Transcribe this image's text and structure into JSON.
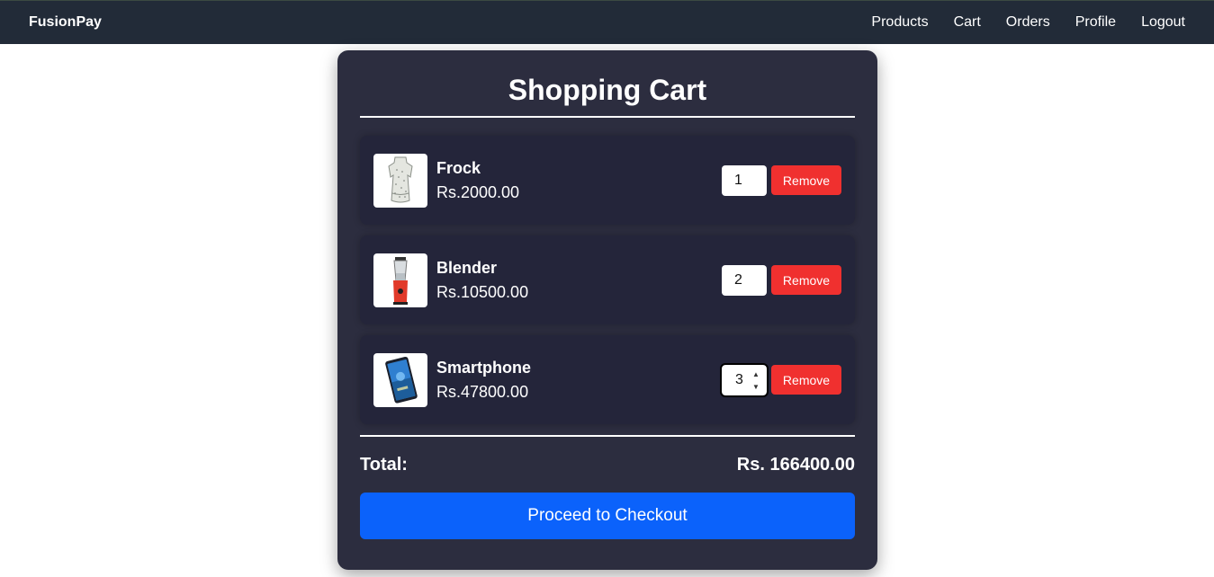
{
  "nav": {
    "brand": "FusionPay",
    "links": [
      "Products",
      "Cart",
      "Orders",
      "Profile",
      "Logout"
    ]
  },
  "cart": {
    "title": "Shopping Cart",
    "items": [
      {
        "name": "Frock",
        "price": "Rs.2000.00",
        "qty": "1",
        "remove_label": "Remove",
        "image_icon": "frock-image"
      },
      {
        "name": "Blender",
        "price": "Rs.10500.00",
        "qty": "2",
        "remove_label": "Remove",
        "image_icon": "blender-image"
      },
      {
        "name": "Smartphone",
        "price": "Rs.47800.00",
        "qty": "3",
        "remove_label": "Remove",
        "image_icon": "smartphone-image"
      }
    ],
    "total_label": "Total:",
    "total_value": "Rs. 166400.00",
    "checkout_label": "Proceed to Checkout"
  },
  "colors": {
    "navbar": "#222b38",
    "card": "#2c2d3f",
    "item": "#24253a",
    "remove": "#f0302f",
    "checkout": "#0b62fb"
  }
}
